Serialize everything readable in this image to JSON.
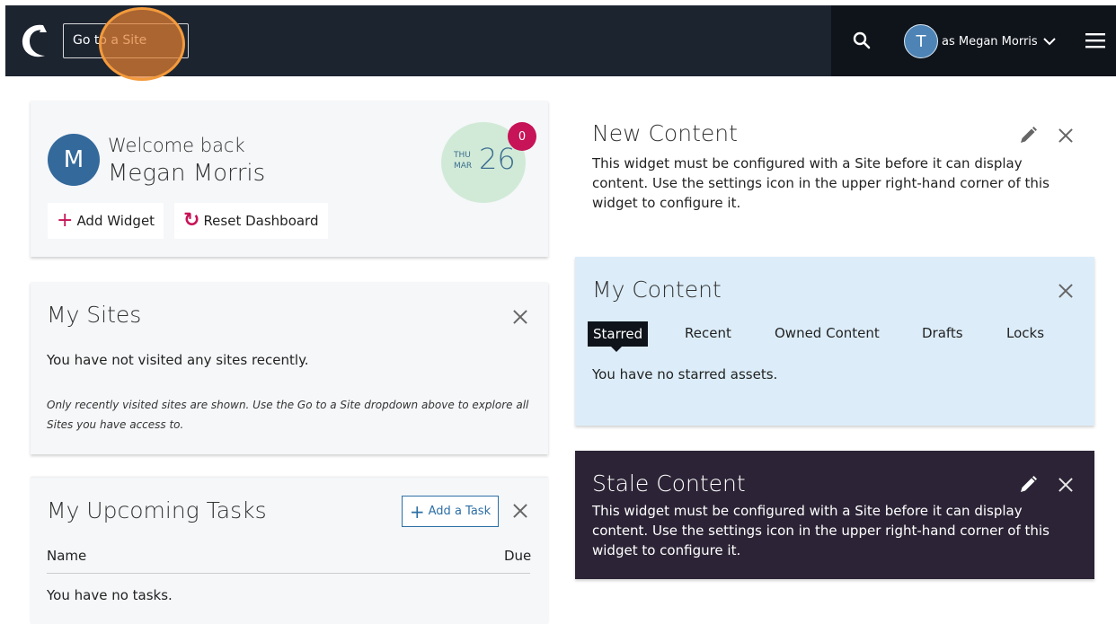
{
  "topbar": {
    "goto_label": "Go to a Site",
    "user_initial": "T",
    "user_label": "as Megan Morris"
  },
  "welcome": {
    "avatar_initial": "M",
    "greeting": "Welcome back",
    "name": "Megan Morris",
    "add_widget_label": "Add Widget",
    "reset_label": "Reset Dashboard",
    "date_dow": "THU",
    "date_month": "MAR",
    "date_day": "26",
    "badge_count": "0"
  },
  "my_sites": {
    "title": "My Sites",
    "empty_text": "You have not visited any sites recently.",
    "note": "Only recently visited sites are shown. Use the Go to a Site dropdown above to explore all Sites you have access to."
  },
  "tasks": {
    "title": "My Upcoming Tasks",
    "add_label": "Add a Task",
    "col_name": "Name",
    "col_due": "Due",
    "empty_text": "You have no tasks."
  },
  "new_content": {
    "title": "New Content",
    "message": "This widget must be configured with a Site before it can display content. Use the settings icon in the upper right-hand corner of this widget to configure it."
  },
  "my_content": {
    "title": "My Content",
    "tabs": [
      "Starred",
      "Recent",
      "Owned Content",
      "Drafts",
      "Locks"
    ],
    "empty_text": "You have no starred assets."
  },
  "stale_content": {
    "title": "Stale Content",
    "message": "This widget must be configured with a Site before it can display content. Use the settings icon in the upper right-hand corner of this widget to configure it."
  },
  "colors": {
    "topbar": "#1c2430",
    "accent": "#c71357",
    "link_blue": "#2d6fa5",
    "my_content_bg": "#dcedf9",
    "stale_bg": "#2c2436"
  }
}
